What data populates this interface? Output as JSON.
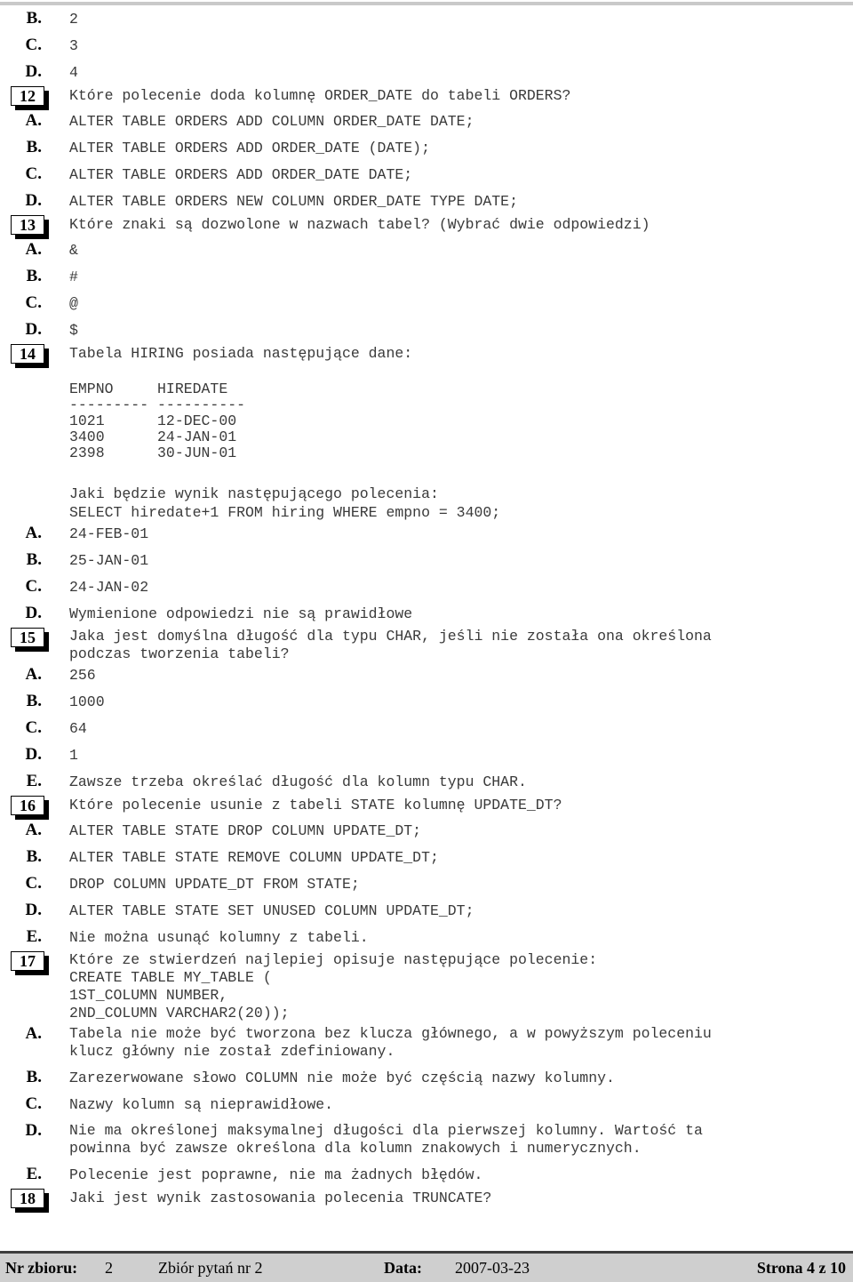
{
  "document": {
    "language": "pl",
    "kind": "exam-question-sheet"
  },
  "carryover_options": [
    {
      "letter": "B.",
      "text": "2"
    },
    {
      "letter": "C.",
      "text": "3"
    },
    {
      "letter": "D.",
      "text": "4"
    }
  ],
  "questions": [
    {
      "number": "12",
      "prompt": "Które polecenie doda kolumnę ORDER_DATE do tabeli ORDERS?",
      "options": [
        {
          "letter": "A.",
          "text": "ALTER TABLE ORDERS ADD COLUMN ORDER_DATE DATE;"
        },
        {
          "letter": "B.",
          "text": "ALTER TABLE ORDERS ADD ORDER_DATE (DATE);"
        },
        {
          "letter": "C.",
          "text": "ALTER TABLE ORDERS ADD ORDER_DATE DATE;"
        },
        {
          "letter": "D.",
          "text": "ALTER TABLE ORDERS NEW COLUMN ORDER_DATE TYPE DATE;"
        }
      ]
    },
    {
      "number": "13",
      "prompt": "Które znaki są dozwolone w nazwach tabel? (Wybrać dwie odpowiedzi)",
      "options": [
        {
          "letter": "A.",
          "text": "&"
        },
        {
          "letter": "B.",
          "text": "#"
        },
        {
          "letter": "C.",
          "text": "@"
        },
        {
          "letter": "D.",
          "text": "$"
        }
      ]
    },
    {
      "number": "14",
      "prompt": "Tabela HIRING posiada następujące dane:",
      "code_table": "EMPNO     HIREDATE\n--------- ----------\n1021      12-DEC-00\n3400      24-JAN-01\n2398      30-JUN-01",
      "sub_prompt": "Jaki będzie wynik następującego polecenia:\nSELECT hiredate+1 FROM hiring WHERE empno = 3400;",
      "options": [
        {
          "letter": "A.",
          "text": "24-FEB-01"
        },
        {
          "letter": "B.",
          "text": "25-JAN-01"
        },
        {
          "letter": "C.",
          "text": "24-JAN-02"
        },
        {
          "letter": "D.",
          "text": "Wymienione odpowiedzi nie są prawidłowe"
        }
      ]
    },
    {
      "number": "15",
      "prompt": "Jaka jest domyślna długość dla typu CHAR, jeśli nie została ona określona\npodczas tworzenia tabeli?",
      "options": [
        {
          "letter": "A.",
          "text": "256"
        },
        {
          "letter": "B.",
          "text": "1000"
        },
        {
          "letter": "C.",
          "text": "64"
        },
        {
          "letter": "D.",
          "text": "1"
        },
        {
          "letter": "E.",
          "text": "Zawsze trzeba określać długość dla kolumn typu CHAR."
        }
      ]
    },
    {
      "number": "16",
      "prompt": "Które polecenie usunie z tabeli STATE kolumnę UPDATE_DT?",
      "options": [
        {
          "letter": "A.",
          "text": "ALTER TABLE STATE DROP COLUMN UPDATE_DT;"
        },
        {
          "letter": "B.",
          "text": "ALTER TABLE STATE REMOVE COLUMN UPDATE_DT;"
        },
        {
          "letter": "C.",
          "text": "DROP COLUMN UPDATE_DT FROM STATE;"
        },
        {
          "letter": "D.",
          "text": "ALTER TABLE STATE SET UNUSED COLUMN UPDATE_DT;"
        },
        {
          "letter": "E.",
          "text": "Nie można usunąć kolumny z tabeli."
        }
      ]
    },
    {
      "number": "17",
      "prompt": "Które ze stwierdzeń najlepiej opisuje następujące polecenie:\nCREATE TABLE MY_TABLE (\n1ST_COLUMN NUMBER,\n2ND_COLUMN VARCHAR2(20));",
      "options": [
        {
          "letter": "A.",
          "text": "Tabela nie może być tworzona bez klucza głównego, a w powyższym poleceniu\nklucz główny nie został zdefiniowany."
        },
        {
          "letter": "B.",
          "text": "Zarezerwowane słowo COLUMN nie może być częścią nazwy kolumny."
        },
        {
          "letter": "C.",
          "text": "Nazwy kolumn są nieprawidłowe."
        },
        {
          "letter": "D.",
          "text": "Nie ma określonej maksymalnej długości dla pierwszej kolumny. Wartość ta\npowinna być zawsze określona dla kolumn znakowych i numerycznych."
        },
        {
          "letter": "E.",
          "text": "Polecenie jest poprawne, nie ma żadnych błędów."
        }
      ]
    },
    {
      "number": "18",
      "prompt": "Jaki jest wynik zastosowania polecenia TRUNCATE?",
      "options": []
    }
  ],
  "footer": {
    "collection_label": "Nr zbioru:",
    "collection_value": "2",
    "set_name": "Zbiór pytań nr 2",
    "date_label": "Data:",
    "date_value": "2007-03-23",
    "page_info": "Strona 4 z 10"
  }
}
